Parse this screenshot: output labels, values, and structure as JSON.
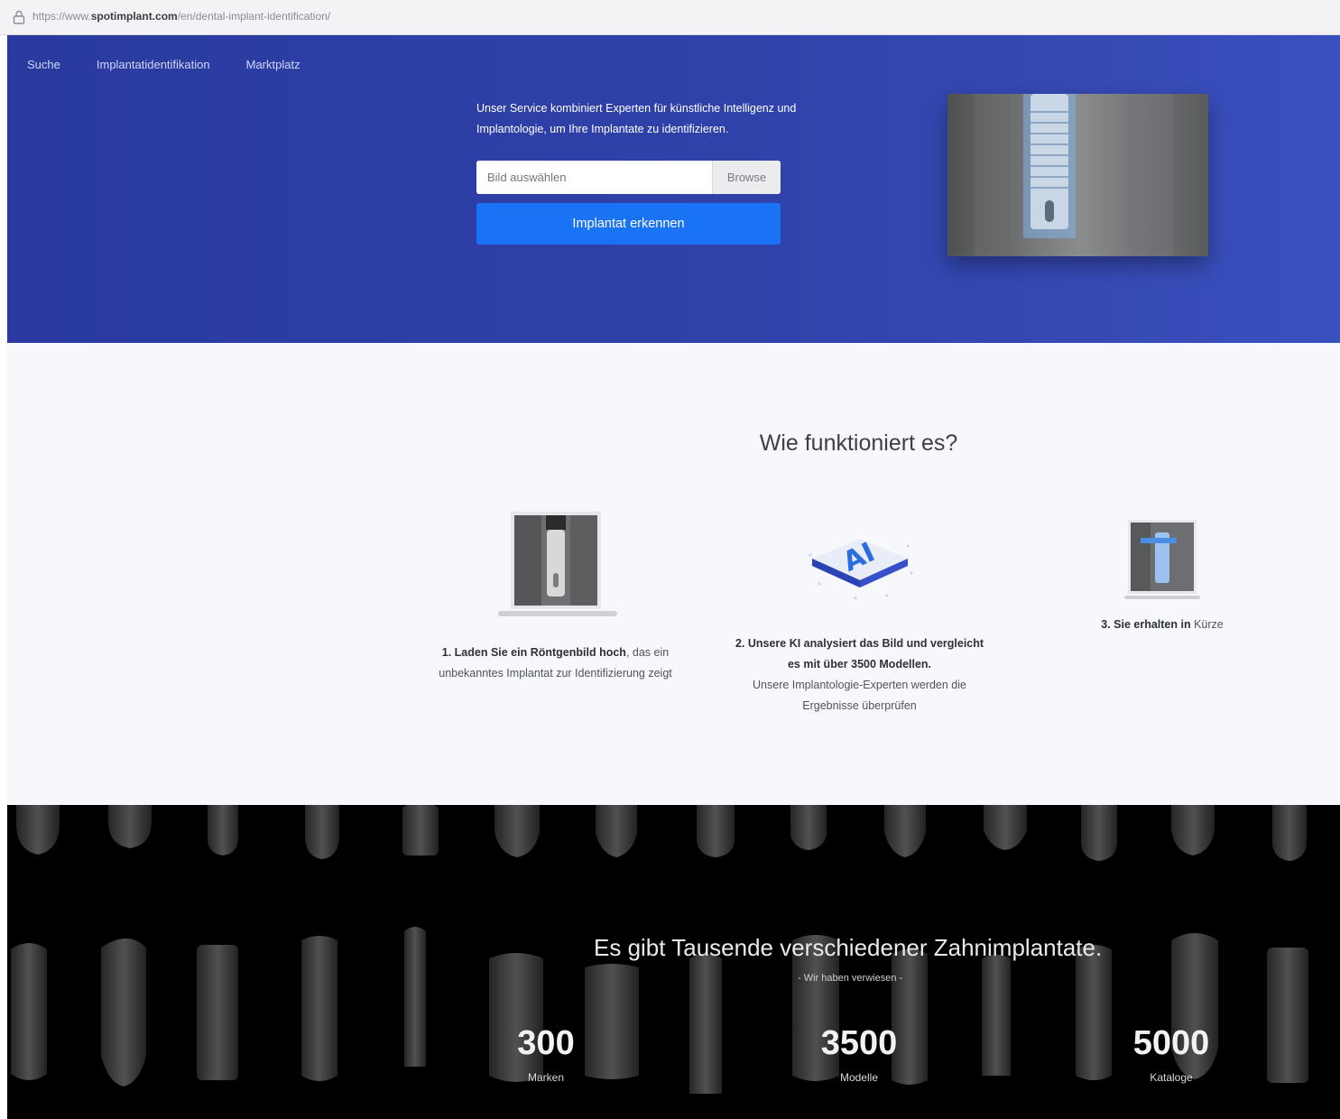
{
  "browser": {
    "url_prefix": "https://www.",
    "url_domain": "spotimplant.com",
    "url_path": "/en/dental-implant-identification/"
  },
  "nav": {
    "items": [
      "Suche",
      "Implantatidentifikation",
      "Marktplatz"
    ]
  },
  "hero": {
    "description": "Unser Service kombiniert Experten für künstliche Intelligenz und Implantologie, um Ihre Implantate zu identifizieren.",
    "file_placeholder": "Bild auswählen",
    "browse_label": "Browse",
    "detect_button": "Implantat erkennen"
  },
  "how_it_works": {
    "title": "Wie funktioniert es?",
    "steps": [
      {
        "bold": "1. Laden Sie ein Röntgenbild hoch",
        "text": ", das ein unbekanntes Implantat zur Identifizierung zeigt"
      },
      {
        "bold": "2. Unsere KI analysiert das Bild und vergleicht es mit über 3500 Modellen.",
        "text": "Unsere Implantologie-Experten werden die Ergebnisse überprüfen"
      },
      {
        "bold": "3. Sie erhalten in",
        "text": "Kürze"
      }
    ],
    "ai_badge": "AI"
  },
  "stats": {
    "heading": "Es gibt Tausende verschiedener Zahnimplantate.",
    "subheading": "- Wir haben verwiesen -",
    "items": [
      {
        "number": "300",
        "label": "Marken"
      },
      {
        "number": "3500",
        "label": "Modelle"
      },
      {
        "number": "5000",
        "label": "Kataloge"
      }
    ]
  },
  "colors": {
    "hero_blue": "#2f42aa",
    "button_blue": "#1a73f5",
    "section_bg": "#f6f8fb",
    "dark_band": "#000000"
  },
  "icons": [
    "lock-icon",
    "ai-chip-icon"
  ]
}
